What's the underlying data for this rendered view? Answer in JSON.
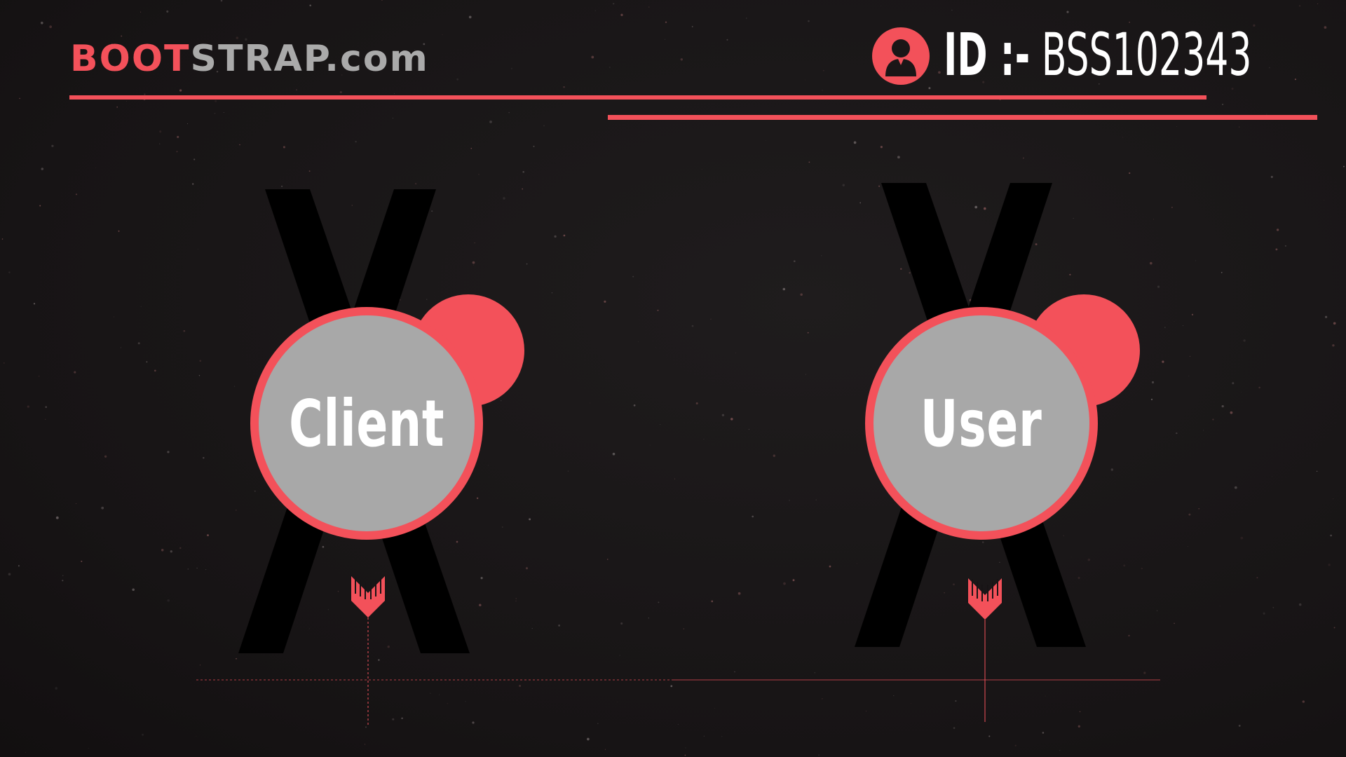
{
  "header": {
    "brand_part1": "BOOT",
    "brand_part2": "STRAP.com",
    "id_label": "ID :-",
    "id_value": "BSS102343",
    "user_icon": "user-avatar-icon"
  },
  "nodes": [
    {
      "label": "Client"
    },
    {
      "label": "User"
    }
  ],
  "colors": {
    "accent": "#f3515a",
    "circle_fill": "#a8a8a8",
    "background": "#171415",
    "cross": "#000000",
    "brand_gray": "#aaaaaa"
  }
}
